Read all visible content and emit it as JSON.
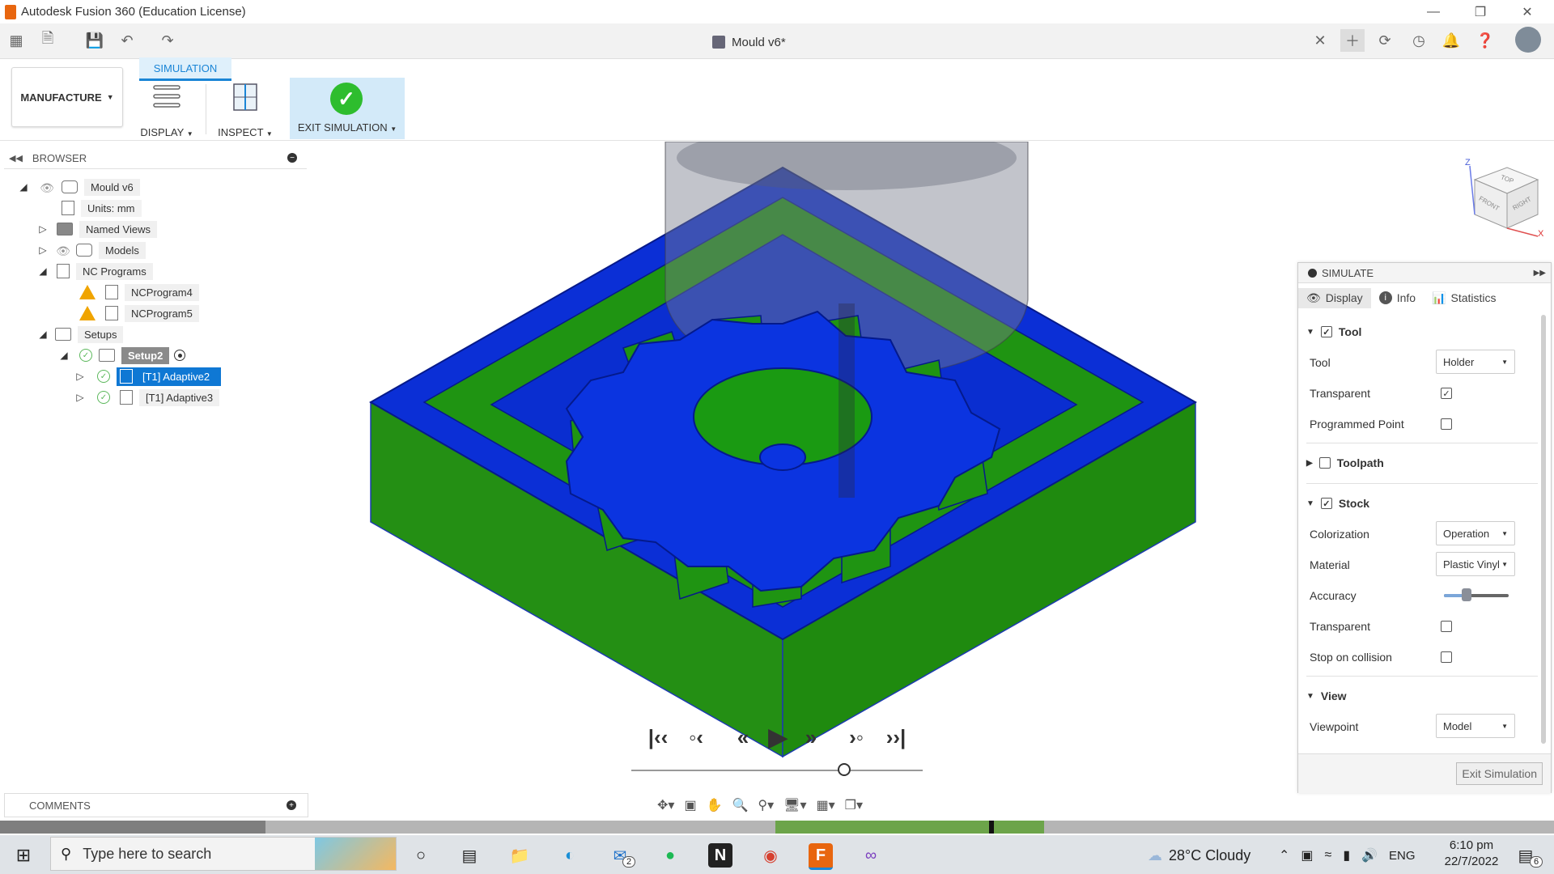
{
  "window": {
    "title": "Autodesk Fusion 360 (Education License)"
  },
  "document": {
    "tab_title": "Mould v6*"
  },
  "ribbon": {
    "workspace": "MANUFACTURE",
    "tab": "SIMULATION",
    "display_label": "DISPLAY",
    "inspect_label": "INSPECT",
    "exit_label": "EXIT SIMULATION"
  },
  "browser": {
    "title": "BROWSER",
    "root": "Mould v6",
    "units": "Units: mm",
    "named_views": "Named Views",
    "models": "Models",
    "nc_programs": "NC Programs",
    "nc_items": [
      "NCProgram4",
      "NCProgram5"
    ],
    "setups": "Setups",
    "setup2": "Setup2",
    "ops": [
      "[T1] Adaptive2",
      "[T1] Adaptive3"
    ]
  },
  "comments": {
    "title": "COMMENTS"
  },
  "viewcube": {
    "top": "TOP",
    "front": "FRONT",
    "right": "RIGHT",
    "z": "Z",
    "x": "X"
  },
  "simulate": {
    "title": "SIMULATE",
    "tabs": [
      "Display",
      "Info",
      "Statistics"
    ],
    "tool_section": "Tool",
    "tool_label": "Tool",
    "tool_value": "Holder",
    "transparent_label": "Transparent",
    "programmed_point_label": "Programmed Point",
    "toolpath_section": "Toolpath",
    "stock_section": "Stock",
    "colorization_label": "Colorization",
    "colorization_value": "Operation",
    "material_label": "Material",
    "material_value": "Plastic Vinyl",
    "accuracy_label": "Accuracy",
    "accuracy_level": 0.35,
    "stock_transparent_label": "Transparent",
    "stop_collision_label": "Stop on collision",
    "view_section": "View",
    "viewpoint_label": "Viewpoint",
    "viewpoint_value": "Model",
    "exit_button": "Exit Simulation"
  },
  "playback": {
    "progress": 0.73
  },
  "taskbar": {
    "search_placeholder": "Type here to search",
    "weather": "28°C  Cloudy",
    "language": "ENG",
    "time": "6:10 pm",
    "date": "22/7/2022",
    "mail_badge": "2",
    "notif_badge": "6"
  },
  "colors": {
    "stock_blue": "#0b2fd6",
    "stock_green": "#1f8a0f",
    "accent": "#1a85d6"
  }
}
